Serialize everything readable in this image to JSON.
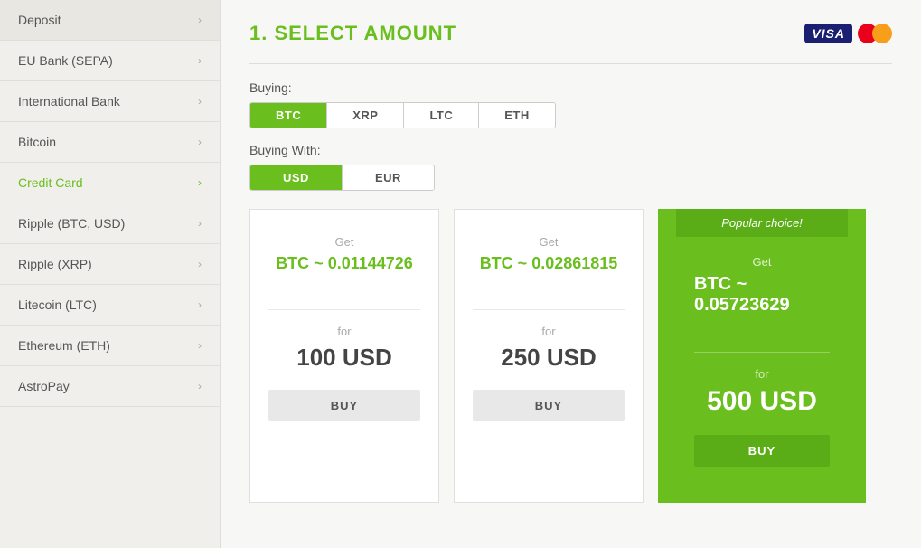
{
  "sidebar": {
    "items": [
      {
        "id": "deposit",
        "label": "Deposit",
        "active": false
      },
      {
        "id": "eu-bank",
        "label": "EU Bank (SEPA)",
        "active": false
      },
      {
        "id": "international-bank",
        "label": "International Bank",
        "active": false
      },
      {
        "id": "bitcoin",
        "label": "Bitcoin",
        "active": false
      },
      {
        "id": "credit-card",
        "label": "Credit Card",
        "active": true
      },
      {
        "id": "ripple-btc",
        "label": "Ripple (BTC, USD)",
        "active": false
      },
      {
        "id": "ripple-xrp",
        "label": "Ripple (XRP)",
        "active": false
      },
      {
        "id": "litecoin",
        "label": "Litecoin (LTC)",
        "active": false
      },
      {
        "id": "ethereum",
        "label": "Ethereum (ETH)",
        "active": false
      },
      {
        "id": "astropay",
        "label": "AstroPay",
        "active": false
      }
    ]
  },
  "main": {
    "section_title": "1. SELECT AMOUNT",
    "buying_label": "Buying:",
    "buying_options": [
      "BTC",
      "XRP",
      "LTC",
      "ETH"
    ],
    "buying_active": "BTC",
    "buying_with_label": "Buying With:",
    "currency_options": [
      "USD",
      "EUR"
    ],
    "currency_active": "USD",
    "popular_badge": "Popular choice!",
    "cards": [
      {
        "get_label": "Get",
        "btc_value": "BTC ~ 0.01144726",
        "for_label": "for",
        "usd_value": "100 USD",
        "buy_label": "BUY",
        "popular": false
      },
      {
        "get_label": "Get",
        "btc_value": "BTC ~ 0.02861815",
        "for_label": "for",
        "usd_value": "250 USD",
        "buy_label": "BUY",
        "popular": false
      },
      {
        "get_label": "Get",
        "btc_value": "BTC ~ 0.05723629",
        "for_label": "for",
        "usd_value": "500 USD",
        "buy_label": "BUY",
        "popular": true
      }
    ]
  }
}
